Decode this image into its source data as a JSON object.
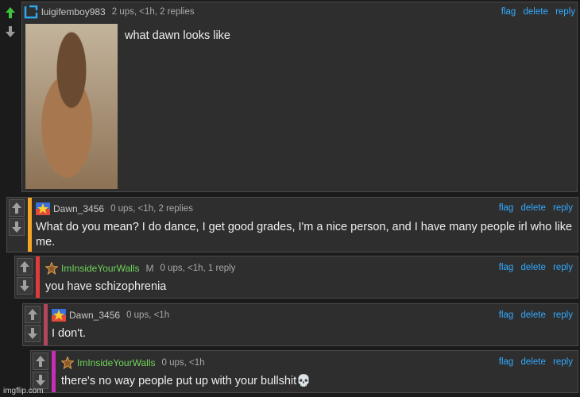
{
  "comments": [
    {
      "user": "luigifemboy983",
      "stats": "2 ups, <1h, 2 replies",
      "text": "what dawn looks like",
      "actions": [
        "flag",
        "delete",
        "reply"
      ]
    },
    {
      "user": "Dawn_3456",
      "stats": "0 ups, <1h, 2 replies",
      "text": "What do you mean? I do dance, I get good grades, I'm a nice person, and I have many people irl who like me.",
      "actions": [
        "flag",
        "delete",
        "reply"
      ],
      "bar_color": "#f5a623"
    },
    {
      "user": "ImInsideYourWalls",
      "mod": "M",
      "stats": "0 ups, <1h, 1 reply",
      "text": "you have schizophrenia",
      "actions": [
        "flag",
        "delete",
        "reply"
      ],
      "bar_color": "#e03b3b"
    },
    {
      "user": "Dawn_3456",
      "stats": "0 ups, <1h",
      "text": "I don't.",
      "actions": [
        "flag",
        "delete",
        "reply"
      ],
      "bar_color": "#b0475b"
    },
    {
      "user": "ImInsideYourWalls",
      "stats": "0 ups, <1h",
      "text": "there's no way people put up with your bullshit💀",
      "actions": [
        "flag",
        "delete",
        "reply"
      ],
      "bar_color": "#c42fb5"
    }
  ],
  "watermark": "imgflip.com",
  "colors": {
    "link": "#33aaff",
    "green_user": "#6fd55a",
    "upvote_active": "#3cc43c"
  },
  "icons": {
    "upvote": "arrow-up-icon",
    "downvote": "arrow-down-icon",
    "avatar": "avatar-icon",
    "star": "star-badge-icon"
  }
}
